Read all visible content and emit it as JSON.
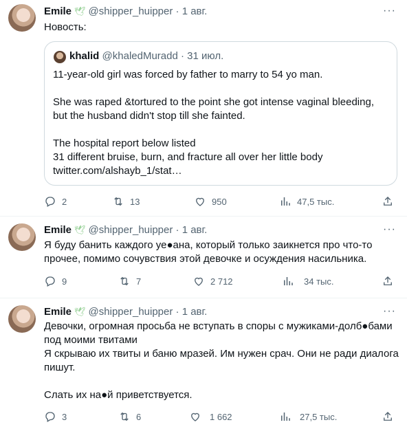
{
  "tweets": [
    {
      "name": "Emile",
      "handle": "@shipper_huipper",
      "dot": "·",
      "date": "1 авг.",
      "more": "···",
      "text": "Новость:",
      "quote": {
        "name": "khalid",
        "handle": "@khaledMuradd",
        "dot": "·",
        "date": "31 июл.",
        "text": "11-year-old girl was forced by father to marry to 54 yo man.\n\nShe was raped &tortured to the point she got intense vaginal bleeding, but the husband didn't stop till she fainted.\n\nThe hospital report below listed\n31 different bruise, burn, and fracture all over her little body\ntwitter.com/alshayb_1/stat…"
      },
      "replies": "2",
      "retweets": "13",
      "likes": "950",
      "views": "47,5 тыс."
    },
    {
      "name": "Emile",
      "handle": "@shipper_huipper",
      "dot": "·",
      "date": "1 авг.",
      "more": "···",
      "text": "Я буду банить каждого уе●ана, который только заикнется про что-то прочее, помимо сочувствия этой девочке и осуждения насильника.",
      "replies": "9",
      "retweets": "7",
      "likes": "2 712",
      "views": "34 тыс."
    },
    {
      "name": "Emile",
      "handle": "@shipper_huipper",
      "dot": "·",
      "date": "1 авг.",
      "more": "···",
      "text": "Девочки, огромная просьба не вступать в споры с мужиками-долб●бами под моими твитами\nЯ скрываю их твиты и баню мразей. Им нужен срач. Они не ради диалога пишут.\n\nСлать их на●й приветствуется.",
      "replies": "3",
      "retweets": "6",
      "likes": "1 662",
      "views": "27,5 тыс."
    }
  ],
  "icons": {
    "reply": "reply-icon",
    "retweet": "retweet-icon",
    "like": "heart-icon",
    "views": "views-icon",
    "share": "share-icon",
    "verified_badge": "dove-icon"
  },
  "colors": {
    "text": "#0f1419",
    "muted": "#536471",
    "border": "#cfd9de",
    "redaction": "#3a0b3a"
  }
}
